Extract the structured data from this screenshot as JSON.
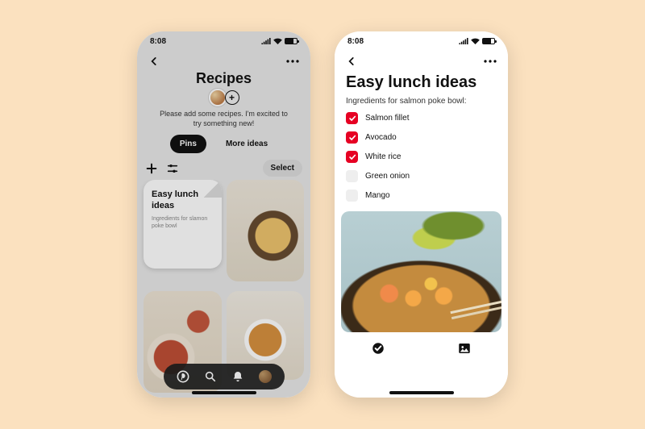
{
  "status": {
    "time": "8:08"
  },
  "left": {
    "title": "Recipes",
    "description": "Please add some recipes. I'm excited to try something new!",
    "tabs": {
      "pins": "Pins",
      "more": "More ideas"
    },
    "select_label": "Select",
    "note": {
      "title": "Easy lunch ideas",
      "subtitle": "Ingredients for slamon poke bowl"
    }
  },
  "right": {
    "title": "Easy lunch ideas",
    "subtitle": "Ingredients for salmon poke bowl:",
    "items": [
      {
        "label": "Salmon fillet",
        "checked": true
      },
      {
        "label": "Avocado",
        "checked": true
      },
      {
        "label": "White rice",
        "checked": true
      },
      {
        "label": "Green onion",
        "checked": false
      },
      {
        "label": "Mango",
        "checked": false
      }
    ]
  }
}
